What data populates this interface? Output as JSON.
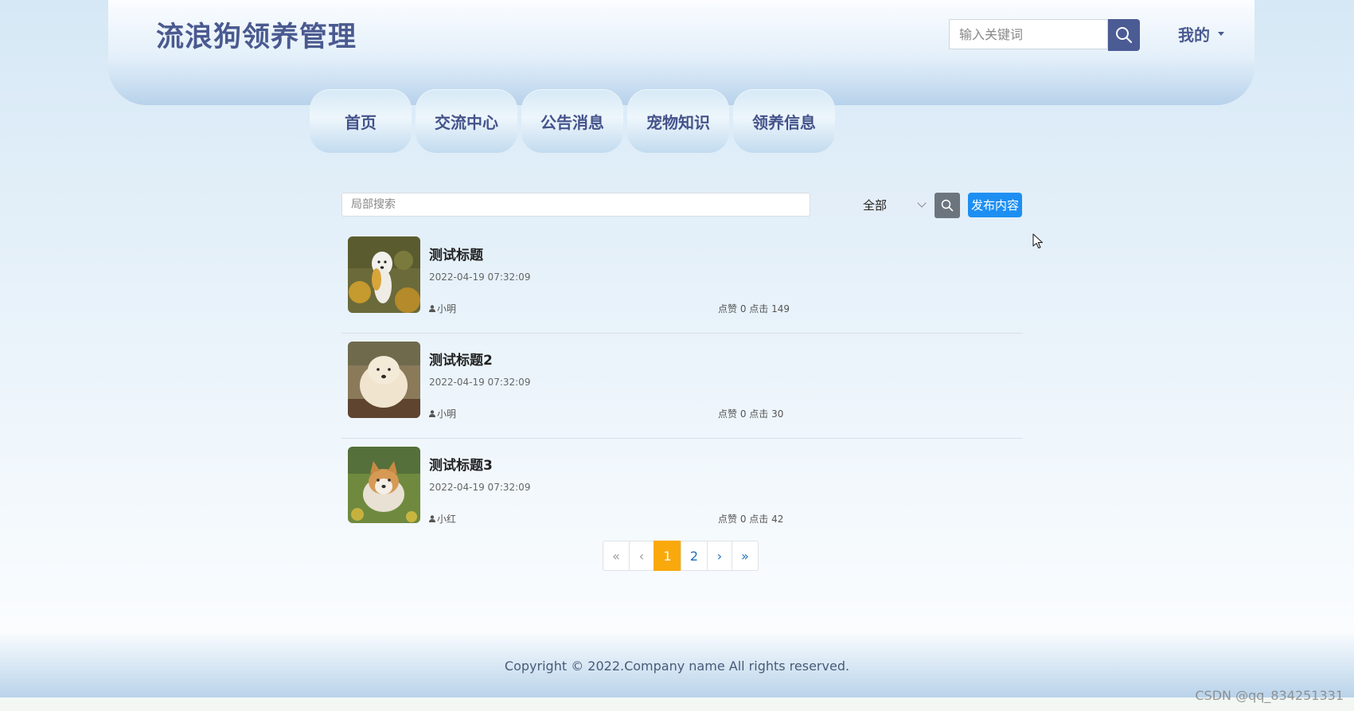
{
  "header": {
    "logo": "流浪狗领养管理",
    "search_placeholder": "输入关键词",
    "user_menu": "我的"
  },
  "nav": [
    "首页",
    "交流中心",
    "公告消息",
    "宠物知识",
    "领养信息"
  ],
  "toolbar": {
    "search_placeholder": "局部搜索",
    "category_selected": "全部",
    "publish_label": "发布内容"
  },
  "posts": [
    {
      "title": "测试标题",
      "date": "2022-04-19 07:32:09",
      "author": "小明",
      "stats": "点赞 0 点击 149"
    },
    {
      "title": "测试标题2",
      "date": "2022-04-19 07:32:09",
      "author": "小明",
      "stats": "点赞 0 点击 30"
    },
    {
      "title": "测试标题3",
      "date": "2022-04-19 07:32:09",
      "author": "小红",
      "stats": "点赞 0 点击 42"
    }
  ],
  "pagination": {
    "first": "«",
    "prev": "‹",
    "pages": [
      "1",
      "2"
    ],
    "current": "1",
    "next": "›",
    "last": "»"
  },
  "footer": {
    "copyright": "Copyright © 2022.Company name All rights reserved."
  },
  "watermark": "CSDN @qq_834251331",
  "colors": {
    "brand": "#4a5a90",
    "publish": "#1e8ff2",
    "active_page": "#f9a90b",
    "filter_button": "#6c757d"
  }
}
